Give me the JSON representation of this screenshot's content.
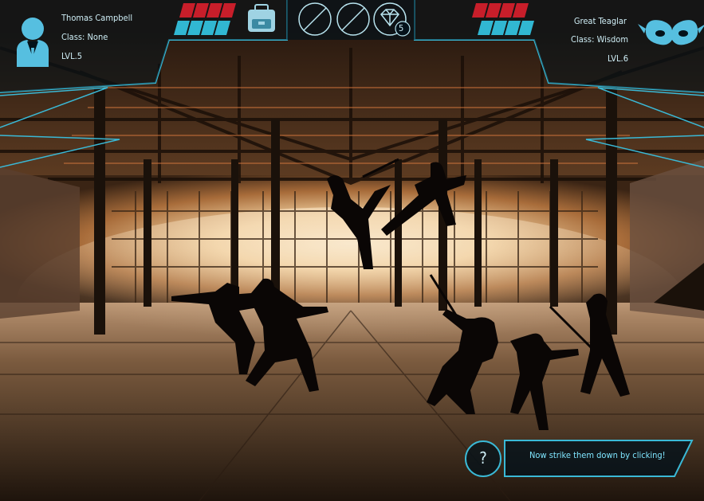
{
  "player": {
    "name": "Thomas Campbell",
    "class_line": "Class: None",
    "level": "LVL.5",
    "health_segments": 4,
    "health_filled": 4,
    "mana_segments": 4,
    "mana_filled": 4
  },
  "opponent": {
    "name": "Great Teaglar",
    "class_line": "Class: Wisdom",
    "level": "LVL.6",
    "health_segments": 4,
    "health_filled": 4,
    "mana_segments": 4,
    "mana_filled": 4
  },
  "toolbar": {
    "gem_count": "5"
  },
  "hint": {
    "help_symbol": "?",
    "message": "Now strike them down by clicking!"
  },
  "colors": {
    "hud_cyan": "#3ab9d6",
    "health_red": "#c81e2a",
    "mana_cyan": "#31b7d2"
  },
  "icons": [
    "user-avatar-icon",
    "backpack-icon",
    "empty-slot-icon",
    "diamond-icon",
    "mask-icon",
    "help-icon"
  ]
}
